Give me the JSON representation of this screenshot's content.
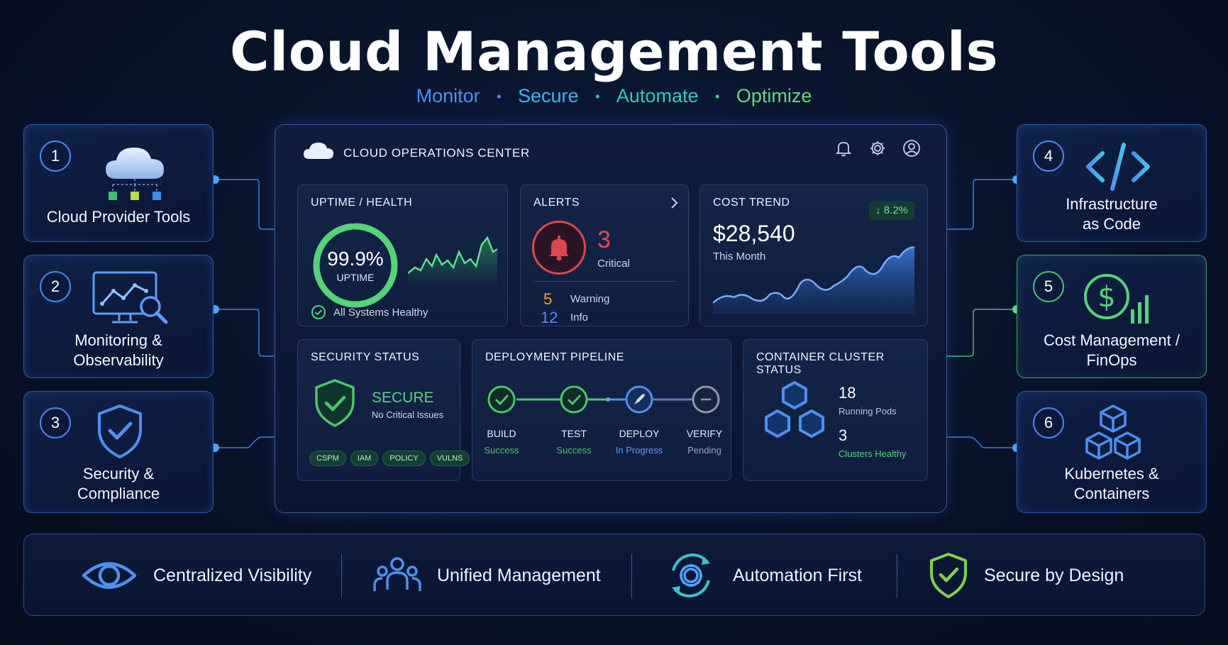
{
  "header": {
    "title": "Cloud Management Tools",
    "tagline": [
      {
        "text": "Monitor",
        "color": "#4f8ff2"
      },
      {
        "text": "Secure",
        "color": "#44b3e8"
      },
      {
        "text": "Automate",
        "color": "#37c7b8"
      },
      {
        "text": "Optimize",
        "color": "#6fd37a"
      }
    ],
    "separator": "•"
  },
  "left_cards": [
    {
      "number": "1",
      "label_lines": [
        "Cloud Provider Tools"
      ],
      "icon": "cloud-network-icon"
    },
    {
      "number": "2",
      "label_lines": [
        "Monitoring &",
        "Observability"
      ],
      "icon": "monitor-chart-icon"
    },
    {
      "number": "3",
      "label_lines": [
        "Security &",
        "Compliance"
      ],
      "icon": "shield-check-icon"
    }
  ],
  "right_cards": [
    {
      "number": "4",
      "label_lines": [
        "Infrastructure",
        "as Code"
      ],
      "icon": "code-icon"
    },
    {
      "number": "5",
      "label_lines": [
        "Cost Management /",
        "FinOps"
      ],
      "icon": "dollar-chart-icon"
    },
    {
      "number": "6",
      "label_lines": [
        "Kubernetes &",
        "Containers"
      ],
      "icon": "cubes-icon"
    }
  ],
  "dashboard": {
    "title": "CLOUD OPERATIONS CENTER",
    "uptime": {
      "title": "UPTIME / HEALTH",
      "value": "99.9%",
      "label": "UPTIME",
      "ring_fraction": 0.999,
      "status": "All Systems Healthy"
    },
    "alerts": {
      "title": "ALERTS",
      "critical_count": "3",
      "critical_label": "Critical",
      "warning_count": "5",
      "warning_label": "Warning",
      "info_count": "12",
      "info_label": "Info"
    },
    "cost": {
      "title": "COST TREND",
      "change": "↓ 8.2%",
      "amount": "$28,540",
      "period": "This Month"
    },
    "security": {
      "title": "SECURITY STATUS",
      "status": "SECURE",
      "detail": "No Critical Issues",
      "tags": [
        "CSPM",
        "IAM",
        "POLICY",
        "VULNS"
      ]
    },
    "pipeline": {
      "title": "DEPLOYMENT PIPELINE",
      "stages": [
        {
          "name": "BUILD",
          "status": "Success",
          "color": "#4cc46a"
        },
        {
          "name": "TEST",
          "status": "Success",
          "color": "#4cc46a"
        },
        {
          "name": "DEPLOY",
          "status": "In Progress",
          "color": "#4f8ff2"
        },
        {
          "name": "VERIFY",
          "status": "Pending",
          "color": "#8e98ac"
        }
      ]
    },
    "containers": {
      "title": "CONTAINER CLUSTER STATUS",
      "pods": "18",
      "pods_label": "Running Pods",
      "clusters": "3",
      "clusters_label": "Clusters Healthy"
    }
  },
  "features": [
    {
      "label": "Centralized Visibility",
      "icon": "eye-icon"
    },
    {
      "label": "Unified Management",
      "icon": "users-icon"
    },
    {
      "label": "Automation First",
      "icon": "automation-gear-icon"
    },
    {
      "label": "Secure by Design",
      "icon": "shield-check-icon"
    }
  ],
  "colors": {
    "accent_blue": "#4f8ff2",
    "accent_green": "#4cc46a",
    "critical_red": "#e0464c",
    "warning_orange": "#f0a23a"
  }
}
